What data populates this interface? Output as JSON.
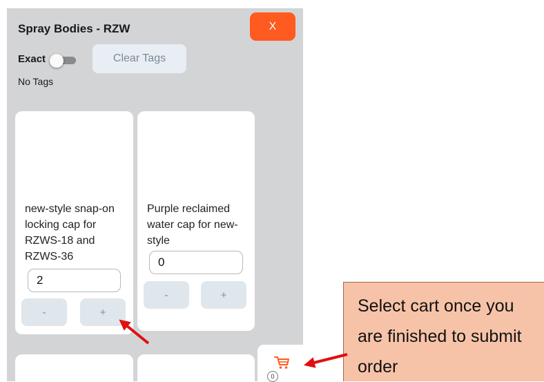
{
  "header": {
    "title": "Spray Bodies - RZW",
    "close_label": "X"
  },
  "filters": {
    "exact_label": "Exact",
    "exact_on": false,
    "clear_tags_label": "Clear Tags",
    "tags_status": "No Tags"
  },
  "products": [
    {
      "name": "new-style snap-on locking cap for RZWS-18 and RZWS-36",
      "quantity": "2",
      "minus_label": "-",
      "plus_label": "+"
    },
    {
      "name": "Purple reclaimed water cap for new-style",
      "quantity": "0",
      "minus_label": "-",
      "plus_label": "+"
    }
  ],
  "cart": {
    "icon": "cart-icon",
    "count": "0"
  },
  "annotation": {
    "text": "Select cart once you are finished to submit order"
  },
  "colors": {
    "accent": "#ff5a1f",
    "panel_bg": "#d3d4d6",
    "callout_bg": "#f7c3a8",
    "arrow": "#e01010"
  }
}
